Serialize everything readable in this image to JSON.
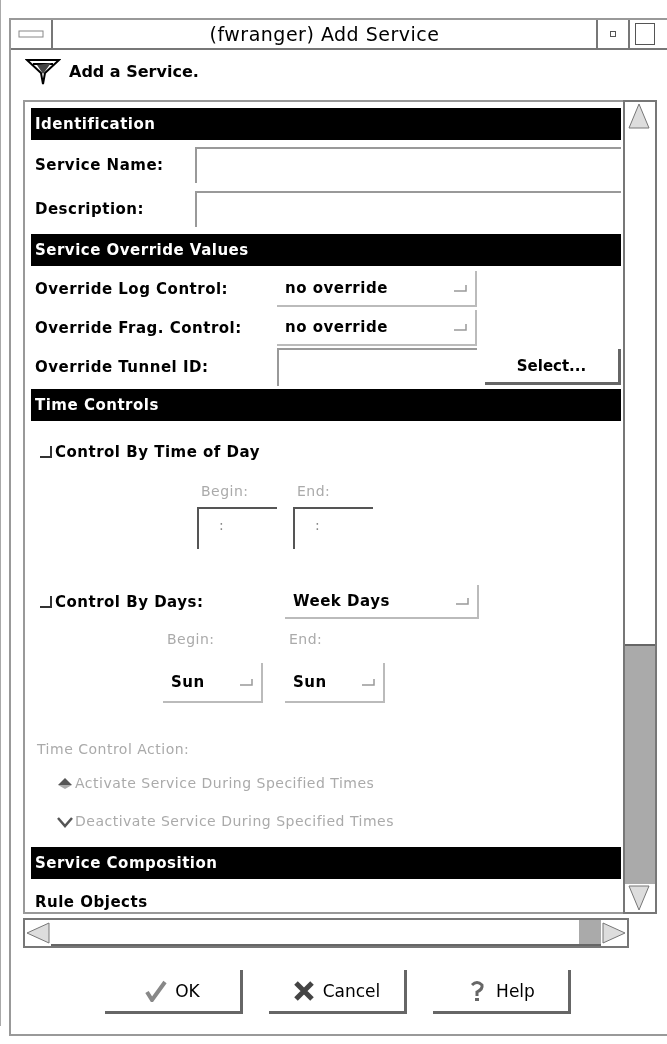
{
  "window": {
    "title": "(fwranger) Add Service"
  },
  "header": {
    "text": "Add a Service."
  },
  "identification": {
    "title": "Identification",
    "fields": [
      {
        "label": "Service Name:"
      },
      {
        "label": "Description:"
      }
    ]
  },
  "override": {
    "title": "Service Override Values",
    "rows": [
      {
        "kind": "menu",
        "label": "Override Log Control:",
        "value": "no override"
      },
      {
        "kind": "menu",
        "label": "Override Frag. Control:",
        "value": "no override"
      },
      {
        "kind": "field",
        "label": "Override Tunnel ID:",
        "button": "Select..."
      }
    ]
  },
  "time_controls": {
    "title": "Time Controls",
    "time_of_day": {
      "label": "Control By Time of Day",
      "checked": false,
      "begin_label": "Begin:",
      "end_label": "End:",
      "begin_value": ":",
      "end_value": ":"
    },
    "days": {
      "label": "Control By Days:",
      "checked": false,
      "mode": "Week Days",
      "begin_label": "Begin:",
      "end_label": "End:",
      "begin": "Sun",
      "end": "Sun"
    },
    "action": {
      "label": "Time Control Action:",
      "disabled": true,
      "options": [
        {
          "label": "Activate Service During Specified Times",
          "selected": true
        },
        {
          "label": "Deactivate Service During Specified Times",
          "selected": false
        }
      ]
    }
  },
  "composition": {
    "title": "Service Composition",
    "items": [
      "Rule Objects"
    ]
  },
  "buttons": [
    {
      "kind": "ok",
      "label": "OK"
    },
    {
      "kind": "cancel",
      "label": "Cancel"
    },
    {
      "kind": "help",
      "label": "Help"
    }
  ]
}
